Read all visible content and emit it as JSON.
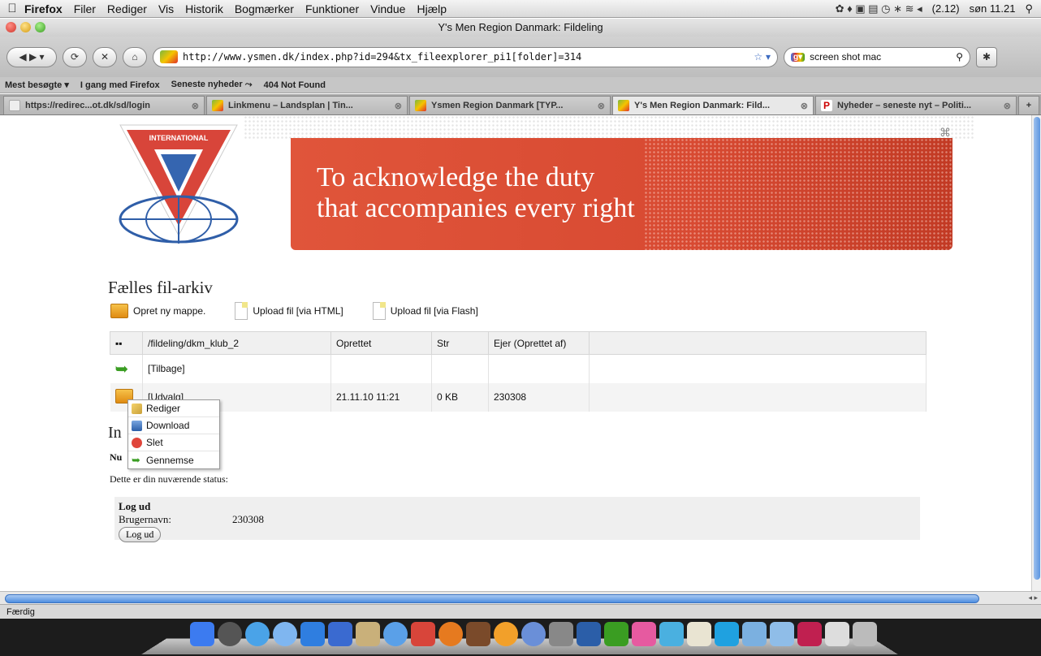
{
  "menubar": {
    "app": "Firefox",
    "items": [
      "Filer",
      "Rediger",
      "Vis",
      "Historik",
      "Bogmærker",
      "Funktioner",
      "Vindue",
      "Hjælp"
    ],
    "battery": "(2.12)",
    "clock": "søn 11.21"
  },
  "window": {
    "title": "Y's Men Region Danmark: Fildeling"
  },
  "navbar": {
    "url": "http://www.ysmen.dk/index.php?id=294&tx_fileexplorer_pi1[folder]=314",
    "search_value": "screen shot mac"
  },
  "bookmarks": [
    "Mest besøgte ▾",
    "I gang med Firefox",
    "Seneste nyheder ⤳",
    "404 Not Found"
  ],
  "tabs": [
    {
      "label": "https://redirec...ot.dk/sd/login",
      "active": false
    },
    {
      "label": "Linkmenu – Landsplan | Tin...",
      "active": false
    },
    {
      "label": "Ysmen Region Danmark [TYP...",
      "active": false
    },
    {
      "label": "Y's Men Region Danmark: Fild...",
      "active": true
    },
    {
      "label": "Nyheder – seneste nyt – Politi...",
      "active": false
    }
  ],
  "banner": {
    "line1": "To acknowledge the duty",
    "line2": "that accompanies every right",
    "logo_text": "INTERNATIONAL"
  },
  "archive": {
    "title": "Fælles fil-arkiv",
    "actions": [
      "Opret ny mappe.",
      "Upload fil [via HTML]",
      "Upload fil [via Flash]"
    ],
    "columns": [
      "/fildeling/dkm_klub_2",
      "Oprettet",
      "Str",
      "Ejer (Oprettet af)"
    ],
    "rows": [
      {
        "name": "[Tilbage]",
        "created": "",
        "size": "",
        "owner": ""
      },
      {
        "name": "[Udvalg]",
        "created": "21.11.10 11:21",
        "size": "0 KB",
        "owner": "230308"
      }
    ]
  },
  "context_menu": [
    "Rediger",
    "Download",
    "Slet",
    "Gennemse"
  ],
  "info": {
    "heading_visible": "In",
    "subheading_visible": "Nu",
    "status_text": "Dette er din nuværende status:",
    "logout_heading": "Log ud",
    "username_label": "Brugernavn:",
    "username_value": "230308",
    "logout_button": "Log ud"
  },
  "statusbar": {
    "text": "Færdig"
  }
}
